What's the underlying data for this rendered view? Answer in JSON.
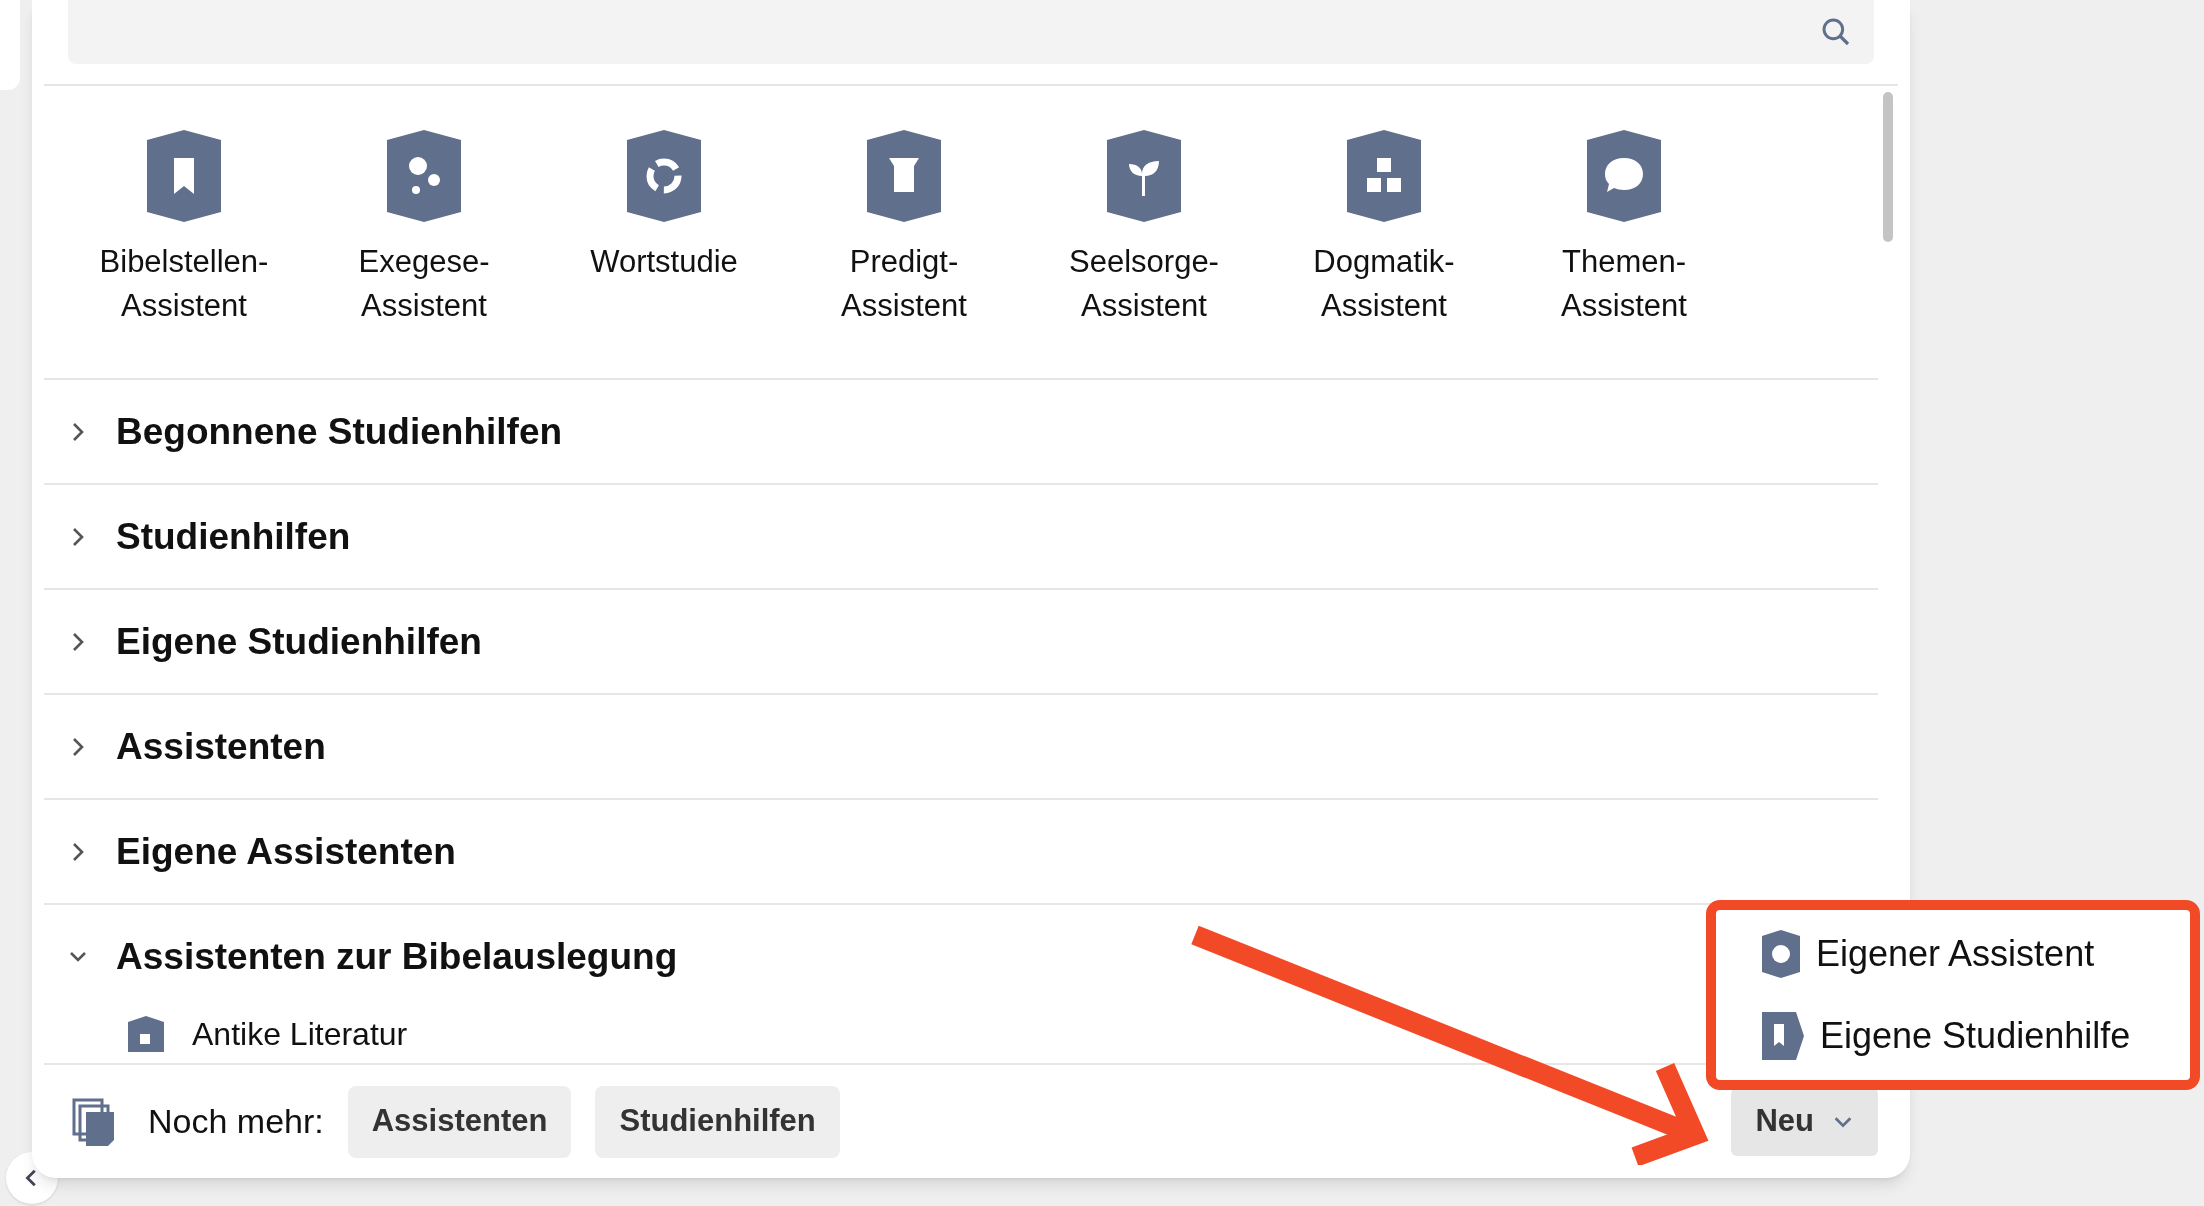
{
  "tools": [
    {
      "lines": [
        "Bibelstellen-",
        "Assistent"
      ]
    },
    {
      "lines": [
        "Exegese-",
        "Assistent"
      ]
    },
    {
      "lines": [
        "Wortstudie"
      ]
    },
    {
      "lines": [
        "Predigt-",
        "Assistent"
      ]
    },
    {
      "lines": [
        "Seelsorge-",
        "Assistent"
      ]
    },
    {
      "lines": [
        "Dogmatik-",
        "Assistent"
      ]
    },
    {
      "lines": [
        "Themen-",
        "Assistent"
      ]
    }
  ],
  "sections": [
    {
      "title": "Begonnene Studienhilfen",
      "expanded": false
    },
    {
      "title": "Studienhilfen",
      "expanded": false
    },
    {
      "title": "Eigene Studienhilfen",
      "expanded": false
    },
    {
      "title": "Assistenten",
      "expanded": false
    },
    {
      "title": "Eigene Assistenten",
      "expanded": false
    },
    {
      "title": "Assistenten zur Bibelauslegung",
      "expanded": true,
      "children": [
        {
          "label": "Antike Literatur"
        }
      ]
    }
  ],
  "footer": {
    "label": "Noch mehr:",
    "buttons": [
      "Assistenten",
      "Studienhilfen"
    ],
    "new_button": {
      "label": "Neu",
      "expanded": true
    }
  },
  "new_menu": [
    {
      "kind": "assistant",
      "label": "Eigener Assistent"
    },
    {
      "kind": "study",
      "label": "Eigene Studienhilfe"
    }
  ]
}
